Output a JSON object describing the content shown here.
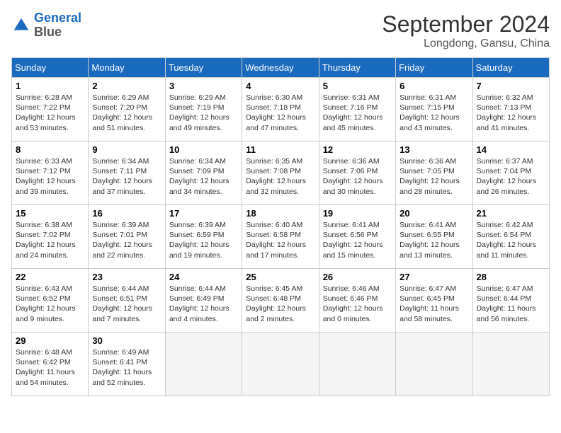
{
  "header": {
    "logo_line1": "General",
    "logo_line2": "Blue",
    "month_year": "September 2024",
    "location": "Longdong, Gansu, China"
  },
  "weekdays": [
    "Sunday",
    "Monday",
    "Tuesday",
    "Wednesday",
    "Thursday",
    "Friday",
    "Saturday"
  ],
  "weeks": [
    [
      {
        "day": "1",
        "rise": "6:28 AM",
        "set": "7:22 PM",
        "hours": "12 hours and 53 minutes."
      },
      {
        "day": "2",
        "rise": "6:29 AM",
        "set": "7:20 PM",
        "hours": "12 hours and 51 minutes."
      },
      {
        "day": "3",
        "rise": "6:29 AM",
        "set": "7:19 PM",
        "hours": "12 hours and 49 minutes."
      },
      {
        "day": "4",
        "rise": "6:30 AM",
        "set": "7:18 PM",
        "hours": "12 hours and 47 minutes."
      },
      {
        "day": "5",
        "rise": "6:31 AM",
        "set": "7:16 PM",
        "hours": "12 hours and 45 minutes."
      },
      {
        "day": "6",
        "rise": "6:31 AM",
        "set": "7:15 PM",
        "hours": "12 hours and 43 minutes."
      },
      {
        "day": "7",
        "rise": "6:32 AM",
        "set": "7:13 PM",
        "hours": "12 hours and 41 minutes."
      }
    ],
    [
      {
        "day": "8",
        "rise": "6:33 AM",
        "set": "7:12 PM",
        "hours": "12 hours and 39 minutes."
      },
      {
        "day": "9",
        "rise": "6:34 AM",
        "set": "7:11 PM",
        "hours": "12 hours and 37 minutes."
      },
      {
        "day": "10",
        "rise": "6:34 AM",
        "set": "7:09 PM",
        "hours": "12 hours and 34 minutes."
      },
      {
        "day": "11",
        "rise": "6:35 AM",
        "set": "7:08 PM",
        "hours": "12 hours and 32 minutes."
      },
      {
        "day": "12",
        "rise": "6:36 AM",
        "set": "7:06 PM",
        "hours": "12 hours and 30 minutes."
      },
      {
        "day": "13",
        "rise": "6:36 AM",
        "set": "7:05 PM",
        "hours": "12 hours and 28 minutes."
      },
      {
        "day": "14",
        "rise": "6:37 AM",
        "set": "7:04 PM",
        "hours": "12 hours and 26 minutes."
      }
    ],
    [
      {
        "day": "15",
        "rise": "6:38 AM",
        "set": "7:02 PM",
        "hours": "12 hours and 24 minutes."
      },
      {
        "day": "16",
        "rise": "6:39 AM",
        "set": "7:01 PM",
        "hours": "12 hours and 22 minutes."
      },
      {
        "day": "17",
        "rise": "6:39 AM",
        "set": "6:59 PM",
        "hours": "12 hours and 19 minutes."
      },
      {
        "day": "18",
        "rise": "6:40 AM",
        "set": "6:58 PM",
        "hours": "12 hours and 17 minutes."
      },
      {
        "day": "19",
        "rise": "6:41 AM",
        "set": "6:56 PM",
        "hours": "12 hours and 15 minutes."
      },
      {
        "day": "20",
        "rise": "6:41 AM",
        "set": "6:55 PM",
        "hours": "12 hours and 13 minutes."
      },
      {
        "day": "21",
        "rise": "6:42 AM",
        "set": "6:54 PM",
        "hours": "12 hours and 11 minutes."
      }
    ],
    [
      {
        "day": "22",
        "rise": "6:43 AM",
        "set": "6:52 PM",
        "hours": "12 hours and 9 minutes."
      },
      {
        "day": "23",
        "rise": "6:44 AM",
        "set": "6:51 PM",
        "hours": "12 hours and 7 minutes."
      },
      {
        "day": "24",
        "rise": "6:44 AM",
        "set": "6:49 PM",
        "hours": "12 hours and 4 minutes."
      },
      {
        "day": "25",
        "rise": "6:45 AM",
        "set": "6:48 PM",
        "hours": "12 hours and 2 minutes."
      },
      {
        "day": "26",
        "rise": "6:46 AM",
        "set": "6:46 PM",
        "hours": "12 hours and 0 minutes."
      },
      {
        "day": "27",
        "rise": "6:47 AM",
        "set": "6:45 PM",
        "hours": "11 hours and 58 minutes."
      },
      {
        "day": "28",
        "rise": "6:47 AM",
        "set": "6:44 PM",
        "hours": "11 hours and 56 minutes."
      }
    ],
    [
      {
        "day": "29",
        "rise": "6:48 AM",
        "set": "6:42 PM",
        "hours": "11 hours and 54 minutes."
      },
      {
        "day": "30",
        "rise": "6:49 AM",
        "set": "6:41 PM",
        "hours": "11 hours and 52 minutes."
      },
      null,
      null,
      null,
      null,
      null
    ]
  ]
}
